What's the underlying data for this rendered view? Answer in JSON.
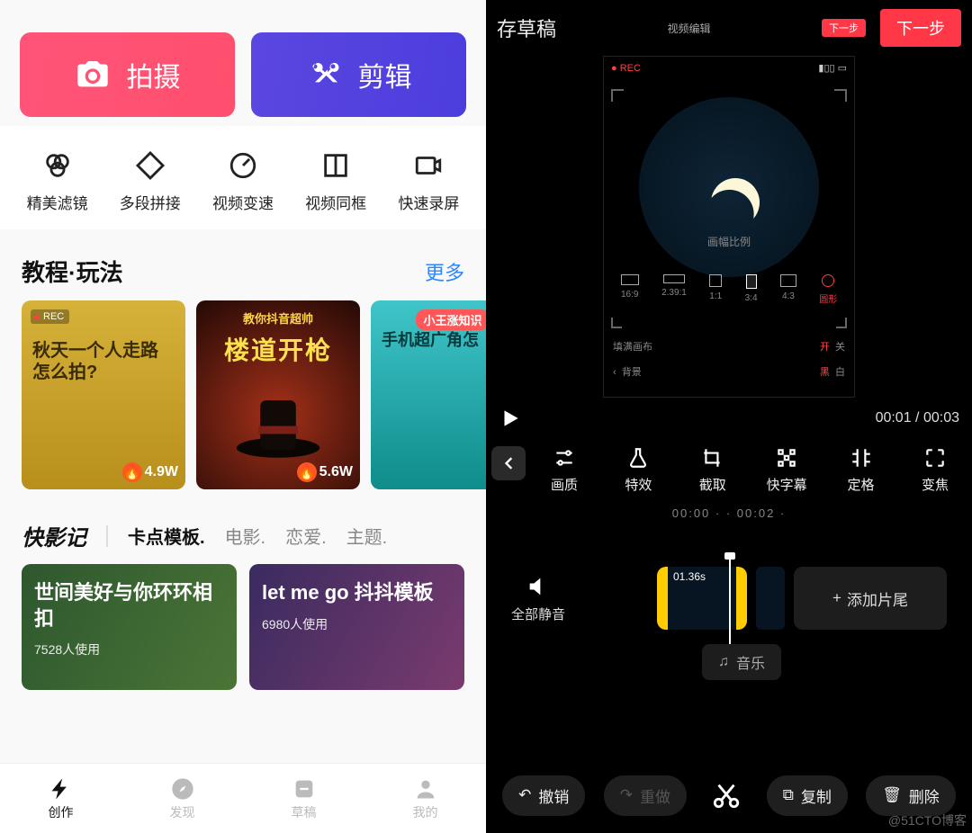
{
  "left": {
    "shoot": "拍摄",
    "edit": "剪辑",
    "tools": [
      "精美滤镜",
      "多段拼接",
      "视频变速",
      "视频同框",
      "快速录屏"
    ],
    "tutorial_title": "教程·玩法",
    "more": "更多",
    "cards": [
      {
        "rec": "REC",
        "title": "秋天一个人走路\n怎么拍?",
        "hot": "4.9W"
      },
      {
        "banner": "教你抖音超帅",
        "title": "楼道开枪",
        "hot": "5.6W"
      },
      {
        "banner": "小王涨知识",
        "title": "手机超广角怎"
      }
    ],
    "cat_brand": "快影记",
    "cats": [
      "卡点模板.",
      "电影.",
      "恋爱.",
      "主题."
    ],
    "templates": [
      {
        "title": "世间美好与你环环相扣",
        "sub": "7528人使用"
      },
      {
        "title": "let me go 抖抖模板",
        "sub": "6980人使用"
      }
    ],
    "nav": [
      "创作",
      "发现",
      "草稿",
      "我的"
    ]
  },
  "right": {
    "draft": "存草稿",
    "header_title": "视频编辑",
    "next": "下一步",
    "rec": "REC",
    "ratio_label": "画幅比例",
    "ratios": [
      "16:9",
      "2.39:1",
      "1:1",
      "3:4",
      "4:3",
      "圆形"
    ],
    "fill_label": "填满画布",
    "on": "开",
    "off": "关",
    "bg_label": "背景",
    "black": "黑",
    "white": "白",
    "time_cur": "00:01",
    "time_total": "00:03",
    "tools": [
      "画质",
      "特效",
      "截取",
      "快字幕",
      "定格",
      "变焦"
    ],
    "ticks": "00:00 ·   · 00:02 ·",
    "mute": "全部静音",
    "clip_dur": "01.36s",
    "add_tail": "添加片尾",
    "music": "音乐",
    "undo": "撤销",
    "redo": "重做",
    "copy": "复制",
    "delete": "删除"
  },
  "watermark": "@51CTO博客"
}
